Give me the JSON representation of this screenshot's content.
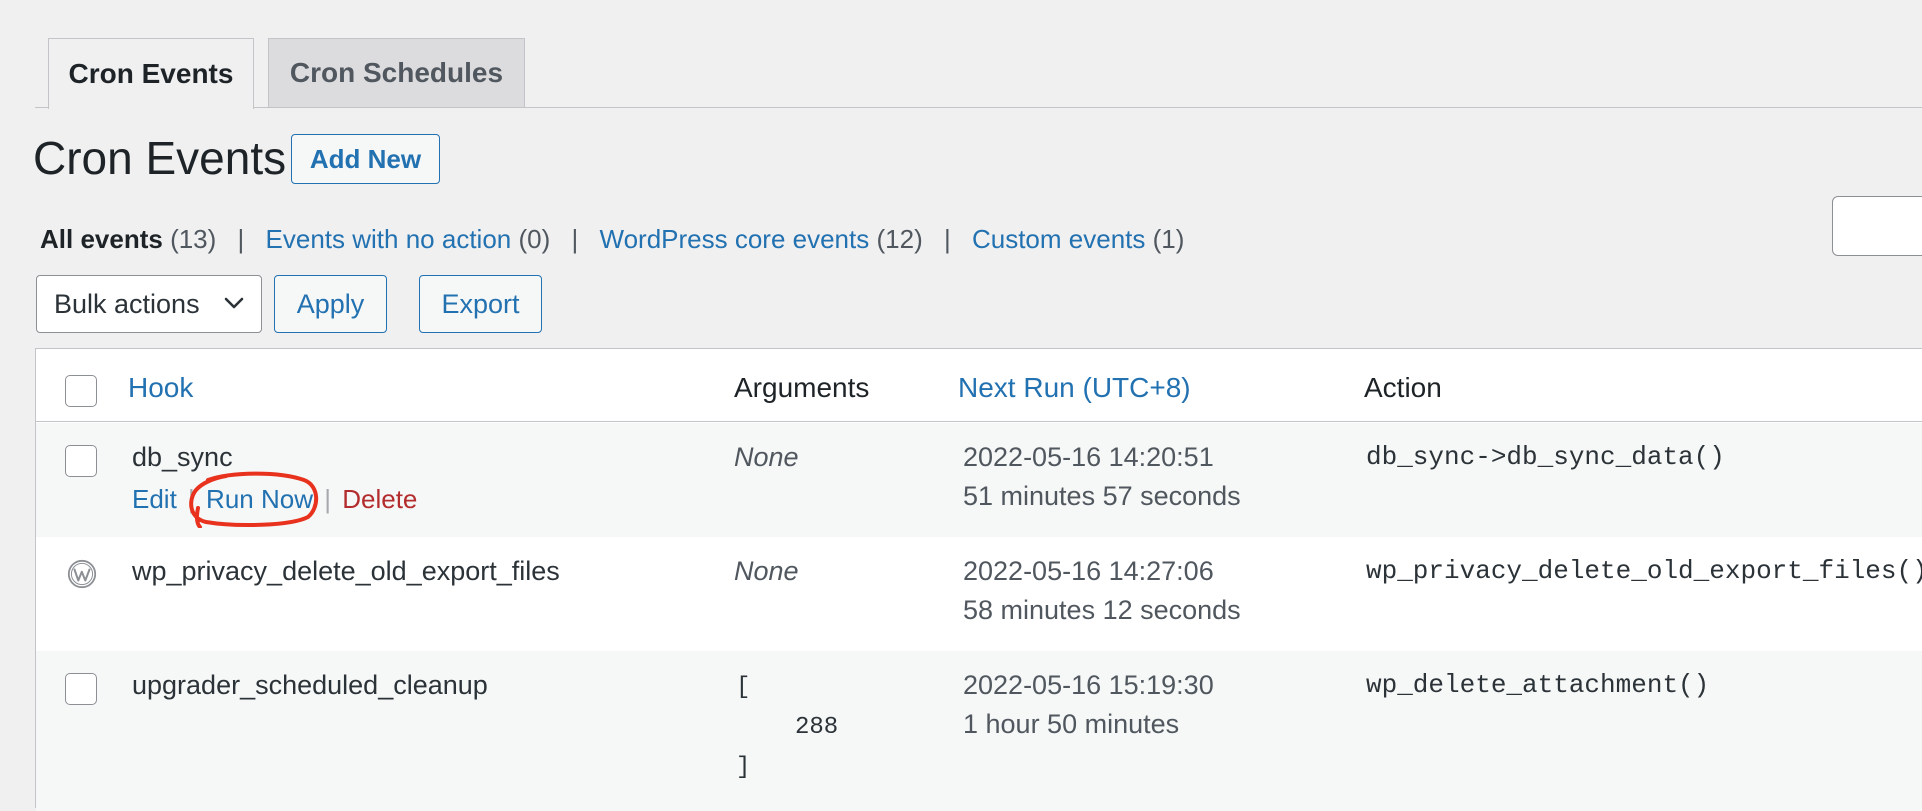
{
  "tabs": [
    {
      "label": "Cron Events",
      "active": true
    },
    {
      "label": "Cron Schedules",
      "active": false
    }
  ],
  "page": {
    "title": "Cron Events",
    "add_new_label": "Add New"
  },
  "views": [
    {
      "label": "All events",
      "count": "(13)",
      "current": true
    },
    {
      "label": "Events with no action",
      "count": "(0)",
      "current": false
    },
    {
      "label": "WordPress core events",
      "count": "(12)",
      "current": false
    },
    {
      "label": "Custom events",
      "count": "(1)",
      "current": false
    }
  ],
  "views_separator": "|",
  "toolbar": {
    "bulk_actions_label": "Bulk actions",
    "apply_label": "Apply",
    "export_label": "Export"
  },
  "table": {
    "columns": {
      "hook": "Hook",
      "arguments": "Arguments",
      "next_run": "Next Run (UTC+8)",
      "action": "Action"
    },
    "rows": [
      {
        "hook": "db_sync",
        "arguments": "None",
        "next_run_date": "2022-05-16 14:20:51",
        "next_run_relative": "51 minutes 57 seconds",
        "action": "db_sync->db_sync_data()",
        "row_actions": {
          "edit": "Edit",
          "run_now": "Run Now",
          "delete": "Delete",
          "separator": "|"
        },
        "selectable": true
      },
      {
        "hook": "wp_privacy_delete_old_export_files",
        "arguments": "None",
        "next_run_date": "2022-05-16 14:27:06",
        "next_run_relative": "58 minutes 12 seconds",
        "action": "wp_privacy_delete_old_export_files()",
        "selectable": false,
        "icon": "wordpress-icon"
      },
      {
        "hook": "upgrader_scheduled_cleanup",
        "arguments_open": "[",
        "arguments_value": "288",
        "arguments_close": "]",
        "next_run_date": "2022-05-16 15:19:30",
        "next_run_relative": "1 hour 50 minutes",
        "action": "wp_delete_attachment()",
        "selectable": true
      }
    ]
  },
  "annotation": {
    "color": "#e8321e",
    "target": "Run Now"
  },
  "colors": {
    "link": "#2271b1",
    "delete": "#b32d2e",
    "background": "#f0f0f1"
  }
}
